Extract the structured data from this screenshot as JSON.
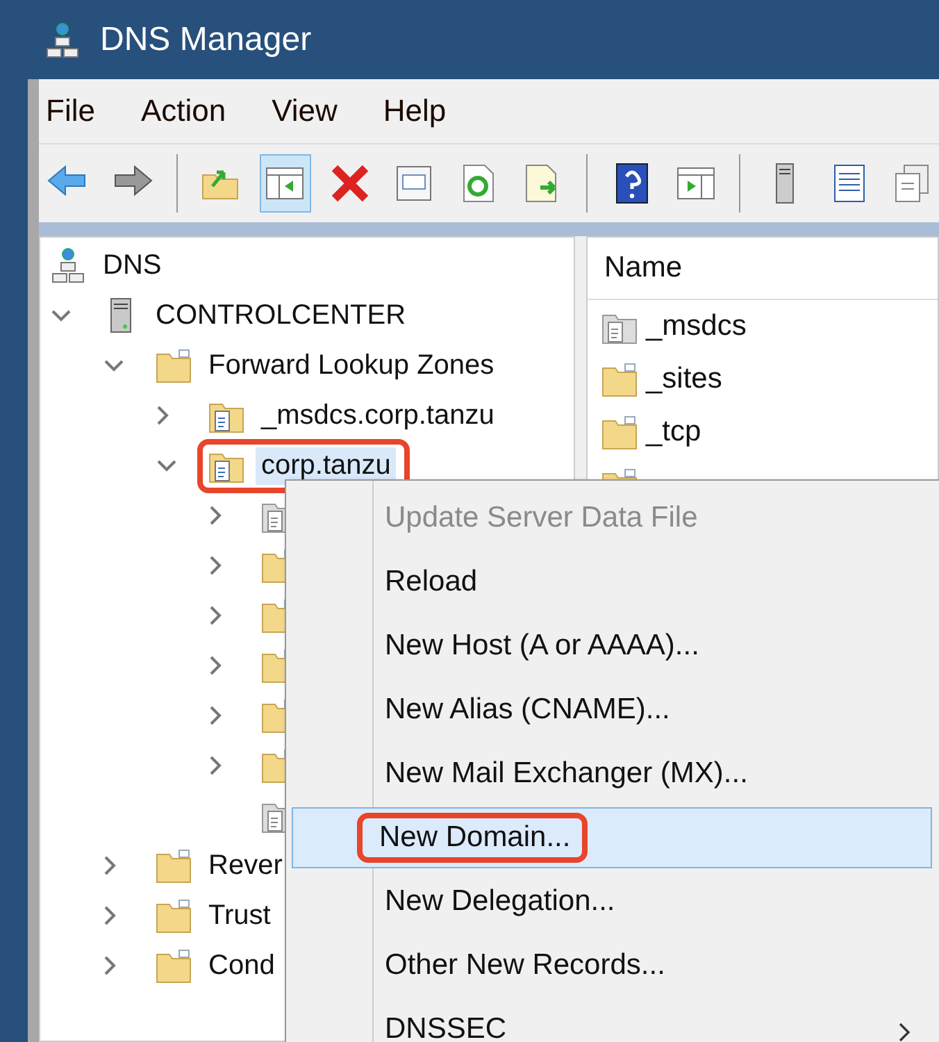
{
  "window": {
    "title": "DNS Manager"
  },
  "menu_bar": [
    "File",
    "Action",
    "View",
    "Help"
  ],
  "toolbar": [
    {
      "kind": "back",
      "selected": false
    },
    {
      "kind": "forward",
      "selected": false
    },
    {
      "kind": "separator"
    },
    {
      "kind": "up",
      "selected": false
    },
    {
      "kind": "show-pane",
      "selected": true
    },
    {
      "kind": "delete",
      "selected": false
    },
    {
      "kind": "properties",
      "selected": false
    },
    {
      "kind": "refresh",
      "selected": false
    },
    {
      "kind": "export",
      "selected": false
    },
    {
      "kind": "separator"
    },
    {
      "kind": "help",
      "selected": false
    },
    {
      "kind": "action-pane",
      "selected": false
    },
    {
      "kind": "separator"
    },
    {
      "kind": "server",
      "selected": false
    },
    {
      "kind": "list",
      "selected": false
    },
    {
      "kind": "copy",
      "selected": false
    }
  ],
  "tree": [
    {
      "label": "DNS",
      "kind": "dns",
      "selected": false,
      "children": [
        {
          "label": "CONTROLCENTER",
          "kind": "server",
          "expanded": true,
          "selected": false,
          "children": [
            {
              "label": "Forward Lookup Zones",
              "kind": "folder",
              "expanded": true,
              "selected": false,
              "children": [
                {
                  "label": "_msdcs.corp.tanzu",
                  "kind": "zone",
                  "expanded": false,
                  "selected": false
                },
                {
                  "label": "corp.tanzu",
                  "kind": "zone",
                  "expanded": true,
                  "selected": true,
                  "highlighted": true,
                  "children": [
                    {
                      "kind": "zonegrey",
                      "expanded": false
                    },
                    {
                      "kind": "folder",
                      "expanded": false
                    },
                    {
                      "kind": "folder",
                      "expanded": false
                    },
                    {
                      "kind": "folder",
                      "expanded": false
                    },
                    {
                      "kind": "folder",
                      "expanded": false
                    },
                    {
                      "kind": "folder",
                      "expanded": false
                    },
                    {
                      "kind": "zonegrey"
                    }
                  ]
                }
              ]
            },
            {
              "label": "Rever",
              "kind": "folder",
              "expanded": false,
              "selected": false
            },
            {
              "label": "Trust",
              "kind": "folder",
              "expanded": false,
              "selected": false
            },
            {
              "label": "Cond",
              "kind": "folder",
              "expanded": false,
              "selected": false
            }
          ]
        }
      ]
    }
  ],
  "list": {
    "columns": [
      "Name"
    ],
    "rows": [
      {
        "name": "_msdcs",
        "kind": "zonegrey"
      },
      {
        "name": "_sites",
        "kind": "folder"
      },
      {
        "name": "_tcp",
        "kind": "folder"
      },
      {
        "kind": "folder"
      }
    ]
  },
  "context_menu": [
    {
      "label": "Update Server Data File",
      "disabled": true,
      "selected": false,
      "highlighted": false
    },
    {
      "label": "Reload",
      "disabled": false,
      "selected": false,
      "highlighted": false
    },
    {
      "label": "New Host (A or AAAA)...",
      "disabled": false,
      "selected": false,
      "highlighted": false
    },
    {
      "label": "New Alias (CNAME)...",
      "disabled": false,
      "selected": false,
      "highlighted": false
    },
    {
      "label": "New Mail Exchanger (MX)...",
      "disabled": false,
      "selected": false,
      "highlighted": false
    },
    {
      "label": "New Domain...",
      "disabled": false,
      "selected": true,
      "highlighted": true
    },
    {
      "label": "New Delegation...",
      "disabled": false,
      "selected": false,
      "highlighted": false
    },
    {
      "label": "Other New Records...",
      "disabled": false,
      "selected": false,
      "highlighted": false
    },
    {
      "label": "DNSSEC",
      "disabled": false,
      "selected": false,
      "highlighted": false,
      "submenu": true
    }
  ]
}
